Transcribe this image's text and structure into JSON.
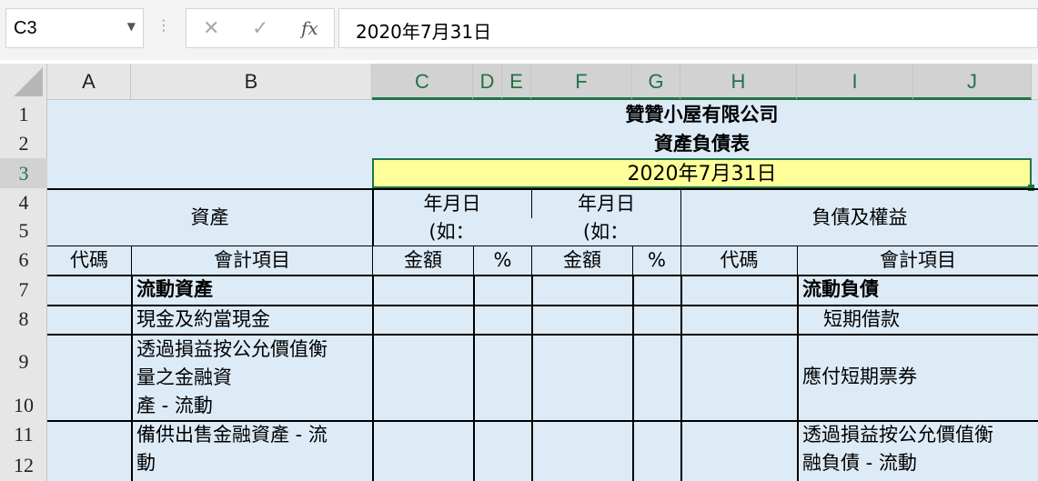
{
  "formula_bar": {
    "name_box": "C3",
    "cancel_icon": "✕",
    "enter_icon": "✓",
    "fx_label": "fx",
    "formula": "2020年7月31日"
  },
  "columns": [
    "A",
    "B",
    "C",
    "D",
    "E",
    "F",
    "G",
    "H",
    "I",
    "J"
  ],
  "rows": [
    "1",
    "2",
    "3",
    "4",
    "5",
    "6",
    "7",
    "8",
    "9",
    "10",
    "11",
    "12"
  ],
  "sheet": {
    "company": "贊贊小屋有限公司",
    "report_title": "資產負債表",
    "date": "2020年7月31日",
    "assets_header": "資產",
    "date_col1_line1": "年月日",
    "date_col1_line2": "(如：",
    "date_col2_line1": "年月日",
    "date_col2_line2": "(如：",
    "liab_header": "負債及權益",
    "code_a": "代碼",
    "item_b": "會計項目",
    "amount_c": "金額",
    "pct_d": "%",
    "amount_f": "金額",
    "pct_g": "%",
    "code_h": "代碼",
    "item_i": "會計項目",
    "b7": "流動資產",
    "i7": "流動負債",
    "b8": "現金及約當現金",
    "i8": "短期借款",
    "b9_line1": "透過損益按公允價值衡",
    "b9_line2": "量之金融資",
    "b9_line3": "產 - 流動",
    "i9": "應付短期票券",
    "b11_line1": "備供出售金融資產 - 流",
    "b11_line2": "動",
    "i11_line1": "透過損益按公允價值衡",
    "i11_line2": "融負債 - 流動"
  },
  "colors": {
    "cell_fill": "#ddebf7",
    "selected_fill": "#ffff99",
    "accent": "#217346"
  }
}
